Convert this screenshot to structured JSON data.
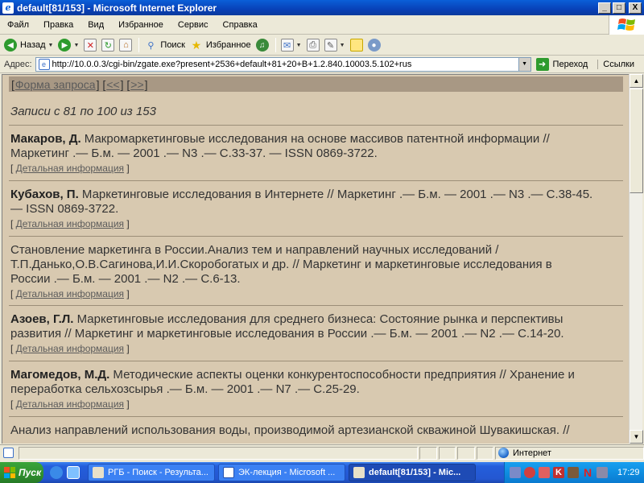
{
  "window": {
    "title": "default[81/153] - Microsoft Internet Explorer",
    "buttons": [
      "_",
      "□",
      "X"
    ]
  },
  "menu": [
    "Файл",
    "Правка",
    "Вид",
    "Избранное",
    "Сервис",
    "Справка"
  ],
  "toolbar": {
    "back": "Назад",
    "search": "Поиск",
    "favorites": "Избранное"
  },
  "address": {
    "label": "Адрес:",
    "url": "http://10.0.0.3/cgi-bin/zgate.exe?present+2536+default+81+20+B+1.2.840.10003.5.102+rus",
    "go": "Переход",
    "links": "Ссылки"
  },
  "page": {
    "nav": {
      "form": "Форма запроса",
      "prev": "<<",
      "next": ">>"
    },
    "records": "Записи с 81 по 100 из 153",
    "detail_label": "Детальная информация",
    "entries": [
      {
        "author": "Макаров, Д.",
        "line1": " Макромаркетинговые исследования на основе массивов патентной информации //",
        "line2": "Маркетинг .— Б.м. — 2001 .— N3 .— С.33-37. — ISSN 0869-3722."
      },
      {
        "author": "Кубахов, П.",
        "line1": " Маркетинговые исследования в Интернете // Маркетинг .— Б.м. — 2001 .— N3 .— С.38-45.",
        "line2": "— ISSN 0869-3722."
      },
      {
        "author": "",
        "line1": "Становление маркетинга в России.Анализ тем и направлений научных исследований /",
        "line2": "Т.П.Данько,О.В.Сагинова,И.И.Скоробогатых и др. // Маркетинг и маркетинговые исследования в",
        "line3": "России .— Б.м. — 2001 .— N2 .— С.6-13."
      },
      {
        "author": "Азоев, Г.Л.",
        "line1": " Маркетинговые исследования для среднего бизнеса: Состояние рынка и перспективы",
        "line2": "развития // Маркетинг и маркетинговые исследования в России .— Б.м. — 2001 .— N2 .— С.14-20."
      },
      {
        "author": "Магомедов, М.Д.",
        "line1": " Методические аспекты оценки конкурентоспособности предприятия // Хранение и",
        "line2": "переработка сельхозсырья .— Б.м. — 2001 .— N7 .— С.25-29."
      },
      {
        "author": "",
        "line1": "Анализ направлений использования воды, производимой артезианской скважиной Шувакишская. //"
      }
    ]
  },
  "status": {
    "zone": "Интернет"
  },
  "taskbar": {
    "start": "Пуск",
    "tasks": [
      "РГБ - Поиск - Результа...",
      "ЭК-лекция - Microsoft ...",
      "default[81/153] - Mic..."
    ],
    "clock": "17:29"
  },
  "colors": {
    "page_bg": "#d8c9b0",
    "nav_strip": "#a89884",
    "text": "#333333"
  }
}
